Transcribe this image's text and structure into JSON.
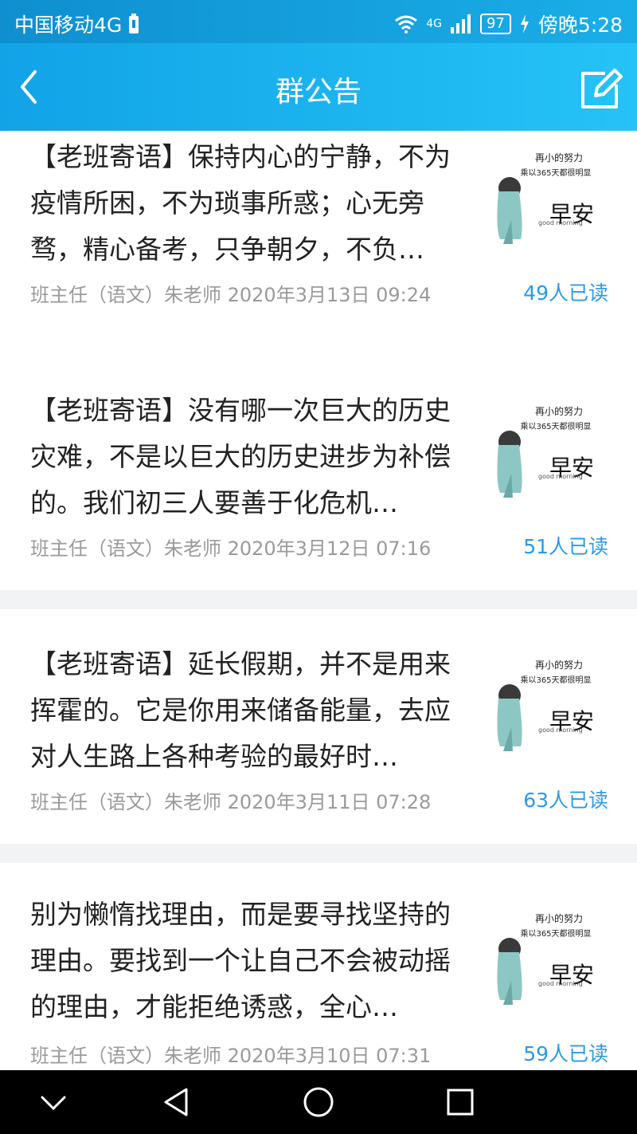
{
  "status": {
    "carrier": "中国移动4G",
    "network": "4G",
    "battery": "97",
    "time_label": "傍晚5:28"
  },
  "header": {
    "title": "群公告"
  },
  "posts": [
    {
      "text": "【老班寄语】保持内心的宁静，不为疫情所困，不为琐事所惑；心无旁骛，精心备考，只争朝夕，不负…",
      "meta": "班主任（语文）朱老师 2020年3月13日 09:24",
      "reads": "49人已读",
      "thumb_top": "再小的努力",
      "thumb_mid": "乘以365天都很明显",
      "thumb_big": "早安",
      "thumb_small": "good morning"
    },
    {
      "text": "【老班寄语】没有哪一次巨大的历史灾难，不是以巨大的历史进步为补偿的。我们初三人要善于化危机…",
      "meta": "班主任（语文）朱老师 2020年3月12日 07:16",
      "reads": "51人已读",
      "thumb_top": "再小的努力",
      "thumb_mid": "乘以365天都很明显",
      "thumb_big": "早安",
      "thumb_small": "good morning"
    },
    {
      "text": "【老班寄语】延长假期，并不是用来挥霍的。它是你用来储备能量，去应对人生路上各种考验的最好时…",
      "meta": "班主任（语文）朱老师 2020年3月11日 07:28",
      "reads": "63人已读",
      "thumb_top": "再小的努力",
      "thumb_mid": "乘以365天都很明显",
      "thumb_big": "早安",
      "thumb_small": "good morning"
    },
    {
      "text": "别为懒惰找理由，而是要寻找坚持的理由。要找到一个让自己不会被动摇的理由，才能拒绝诱惑，全心…",
      "meta": "班主任（语文）朱老师 2020年3月10日 07:31",
      "reads": "59人已读",
      "thumb_top": "再小的努力",
      "thumb_mid": "乘以365天都很明显",
      "thumb_big": "早安",
      "thumb_small": "good morning"
    }
  ],
  "icons": {
    "back": "back-arrow-icon",
    "edit": "edit-icon",
    "nav_down": "chevron-down-icon",
    "nav_back": "triangle-back-icon",
    "nav_home": "circle-home-icon",
    "nav_recent": "square-recent-icon"
  },
  "colors": {
    "header_from": "#11a3e6",
    "header_to": "#25c3f7",
    "read_blue": "#2a9ae6",
    "meta_gray": "#9a9a9a"
  }
}
